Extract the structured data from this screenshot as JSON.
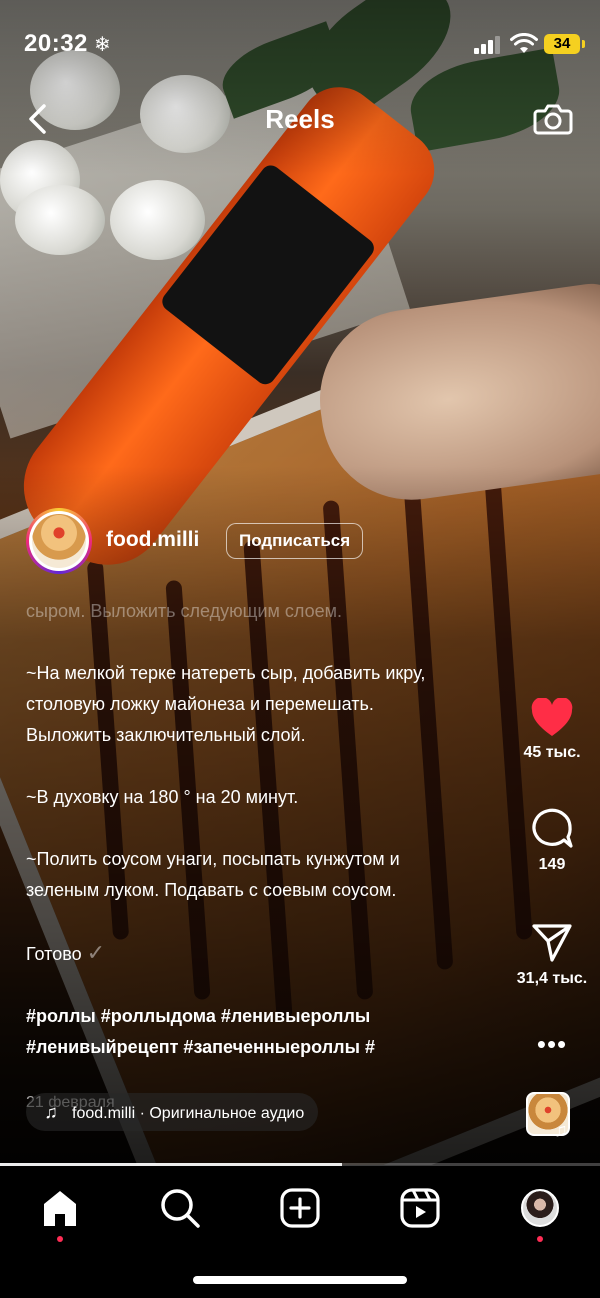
{
  "status_bar": {
    "time": "20:32",
    "snow_icon": "❄",
    "battery": "34",
    "battery_color": "#f5d020"
  },
  "header": {
    "title": "Reels",
    "back_icon": "chevron-left-icon",
    "camera_icon": "camera-icon"
  },
  "author": {
    "username": "food.milli",
    "follow_label": "Подписаться"
  },
  "caption": {
    "faded_line": "сыром. Выложить следующим слоем.",
    "paragraphs": [
      "~На мелкой терке натереть сыр, добавить икру,\nстоловую ложку майонеза и перемешать.\nВыложить заключительный слой.",
      "~В духовку на 180 ° на 20 минут.",
      "~Полить соусом унаги, посыпать кунжутом и\nзеленым луком. Подавать с соевым соусом."
    ],
    "done_text": "Готово",
    "done_icon": "✓",
    "hashtags": "#роллы #роллыдома #ленивыероллы\n#ленивыйрецепт #запеченныероллы #",
    "date": "21 февраля"
  },
  "audio": {
    "text": "food.milli · Оригинальное аудио",
    "note_icon": "♫"
  },
  "actions": {
    "likes": "45 тыс.",
    "comments": "149",
    "shares": "31,4 тыс.",
    "more": "•••",
    "like_color": "#ff2d46"
  },
  "progress": {
    "fraction": 0.57
  },
  "tabbar": {
    "items": [
      "home",
      "search",
      "create",
      "reels",
      "profile"
    ],
    "dot_color": "#ff2d55"
  }
}
